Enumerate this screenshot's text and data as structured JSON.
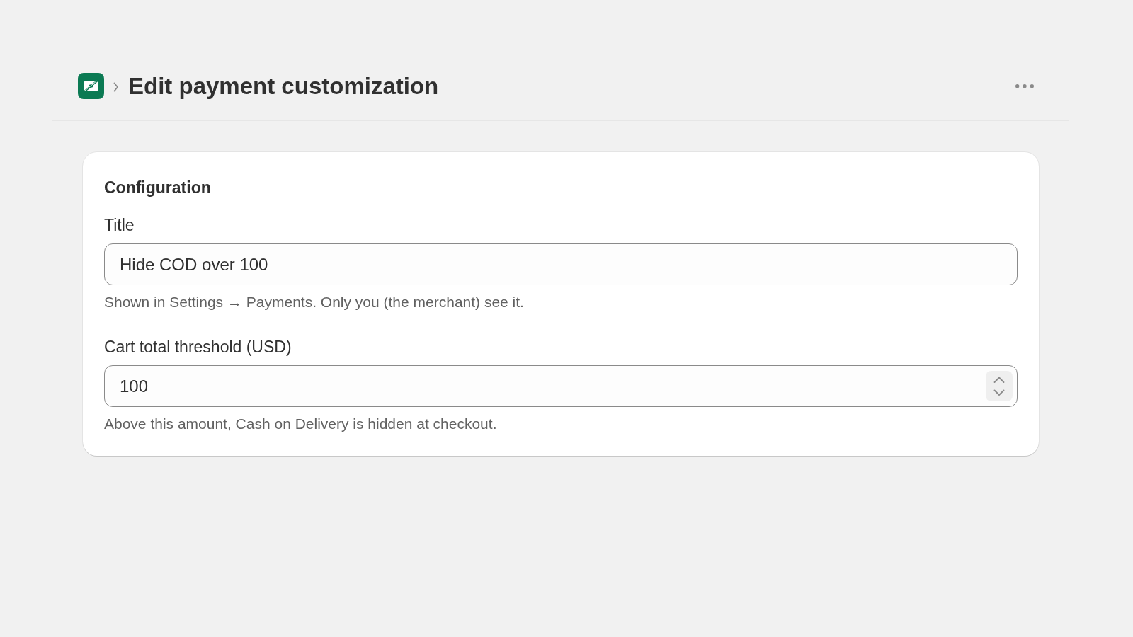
{
  "header": {
    "title": "Edit payment customization"
  },
  "card": {
    "heading": "Configuration",
    "fields": [
      {
        "kind": "text",
        "label": "Title",
        "value": "Hide COD over 100",
        "help": "Shown in Settings → Payments. Only you (the merchant) see it."
      },
      {
        "kind": "number",
        "label": "Cart total threshold (USD)",
        "value": "100",
        "help": "Above this amount, Cash on Delivery is hidden at checkout."
      }
    ]
  }
}
